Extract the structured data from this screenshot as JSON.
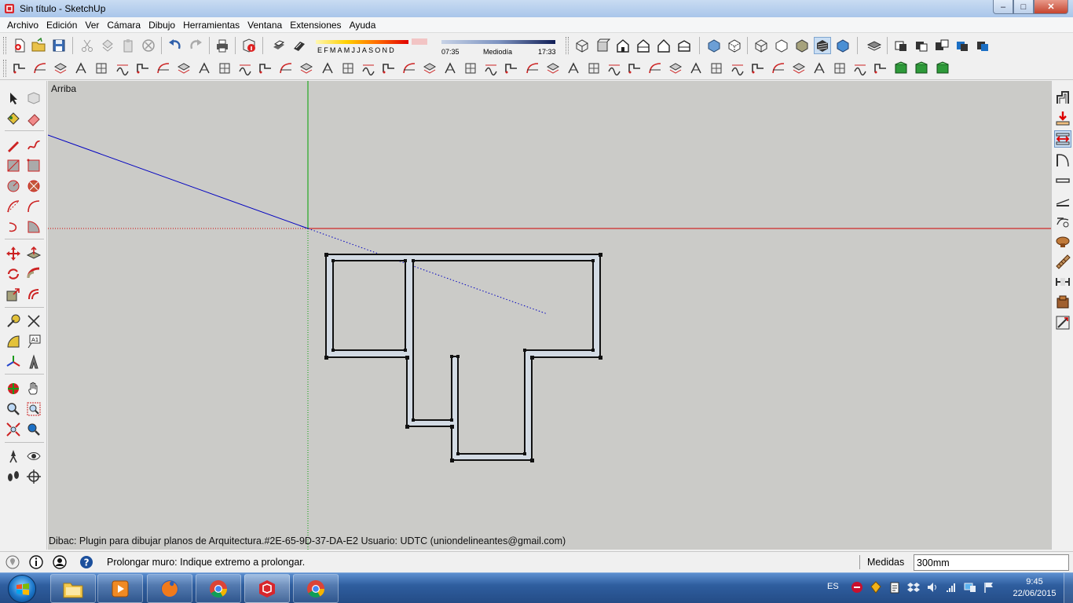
{
  "window": {
    "title": "Sin título - SketchUp",
    "min": "–",
    "max": "□",
    "close": "✕"
  },
  "menu": [
    "Archivo",
    "Edición",
    "Ver",
    "Cámara",
    "Dibujo",
    "Herramientas",
    "Ventana",
    "Extensiones",
    "Ayuda"
  ],
  "shadows": {
    "months": "EFMAMJJASOND",
    "time_start": "07:35",
    "time_mid": "Mediodía",
    "time_end": "17:33"
  },
  "viewport": {
    "view_name": "Arriba",
    "plugin_info": "Dibac: Plugin para dibujar planos de Arquitectura.#2E-65-9D-37-DA-E2 Usuario: UDTC (uniondelineantes@gmail.com)",
    "background": "#cbcbc8",
    "axis_red": "#d00000",
    "axis_green": "#00a000",
    "axis_blue": "#0000c0",
    "wall_fill": "#d3dbe4"
  },
  "status": {
    "message": "Prolongar muro: Indique extremo a prolongar.",
    "measure_label": "Medidas",
    "measure_value": "300mm"
  },
  "taskbar": {
    "language": "ES",
    "time": "9:45",
    "date": "22/06/2015",
    "apps": [
      "explorer-icon",
      "media-player-icon",
      "firefox-icon",
      "chrome-icon",
      "sketchup-icon",
      "chrome-icon"
    ]
  }
}
